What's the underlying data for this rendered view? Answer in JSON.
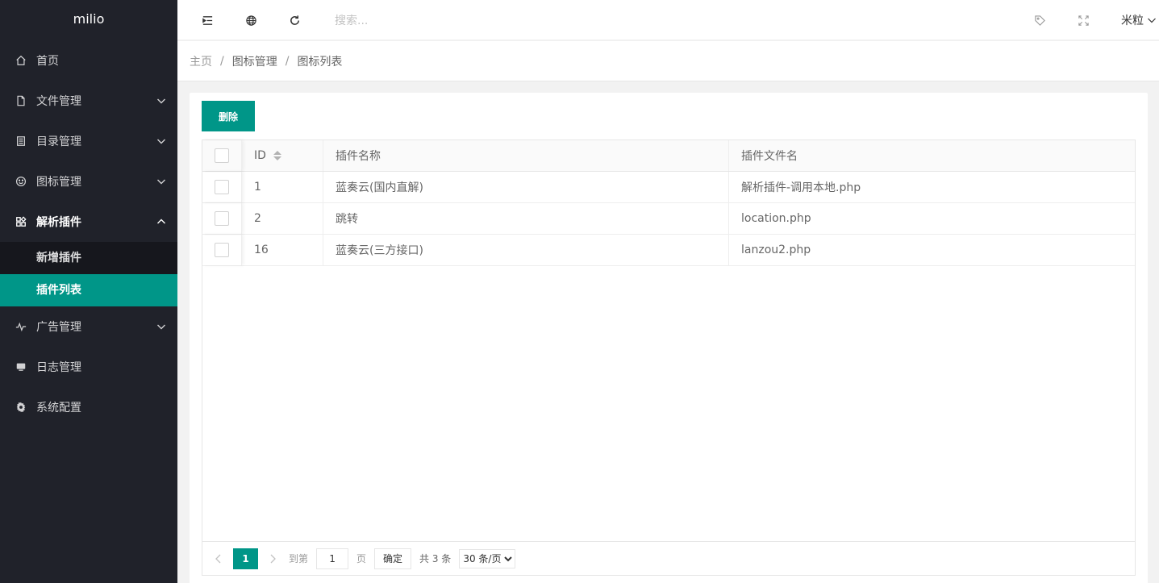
{
  "app": {
    "logo": "milio"
  },
  "sidebar": {
    "items": [
      {
        "label": "首页",
        "icon": "home-icon"
      },
      {
        "label": "文件管理",
        "icon": "file-icon"
      },
      {
        "label": "目录管理",
        "icon": "list-icon"
      },
      {
        "label": "图标管理",
        "icon": "smile-icon"
      },
      {
        "label": "解析插件",
        "icon": "apps-icon"
      },
      {
        "label": "广告管理",
        "icon": "pulse-icon"
      },
      {
        "label": "日志管理",
        "icon": "monitor-icon"
      },
      {
        "label": "系统配置",
        "icon": "gear-icon"
      }
    ],
    "sub_items": [
      {
        "label": "新增插件"
      },
      {
        "label": "插件列表"
      }
    ]
  },
  "header": {
    "search_placeholder": "搜索...",
    "user": "米粒"
  },
  "breadcrumb": [
    "主页",
    "图标管理",
    "图标列表"
  ],
  "toolbar": {
    "delete_label": "删除"
  },
  "table": {
    "columns": [
      "ID",
      "插件名称",
      "插件文件名"
    ],
    "rows": [
      {
        "id": "1",
        "name": "蓝奏云(国内直解)",
        "file": "解析插件-调用本地.php"
      },
      {
        "id": "2",
        "name": "跳转",
        "file": "location.php"
      },
      {
        "id": "16",
        "name": "蓝奏云(三方接口)",
        "file": "lanzou2.php"
      }
    ]
  },
  "pager": {
    "current": "1",
    "goto_label": "到第",
    "page_value": "1",
    "page_unit": "页",
    "confirm": "确定",
    "total": "共 3 条",
    "per_page": "30 条/页"
  },
  "colors": {
    "accent": "#009688",
    "sidebar_bg": "#20222a"
  }
}
